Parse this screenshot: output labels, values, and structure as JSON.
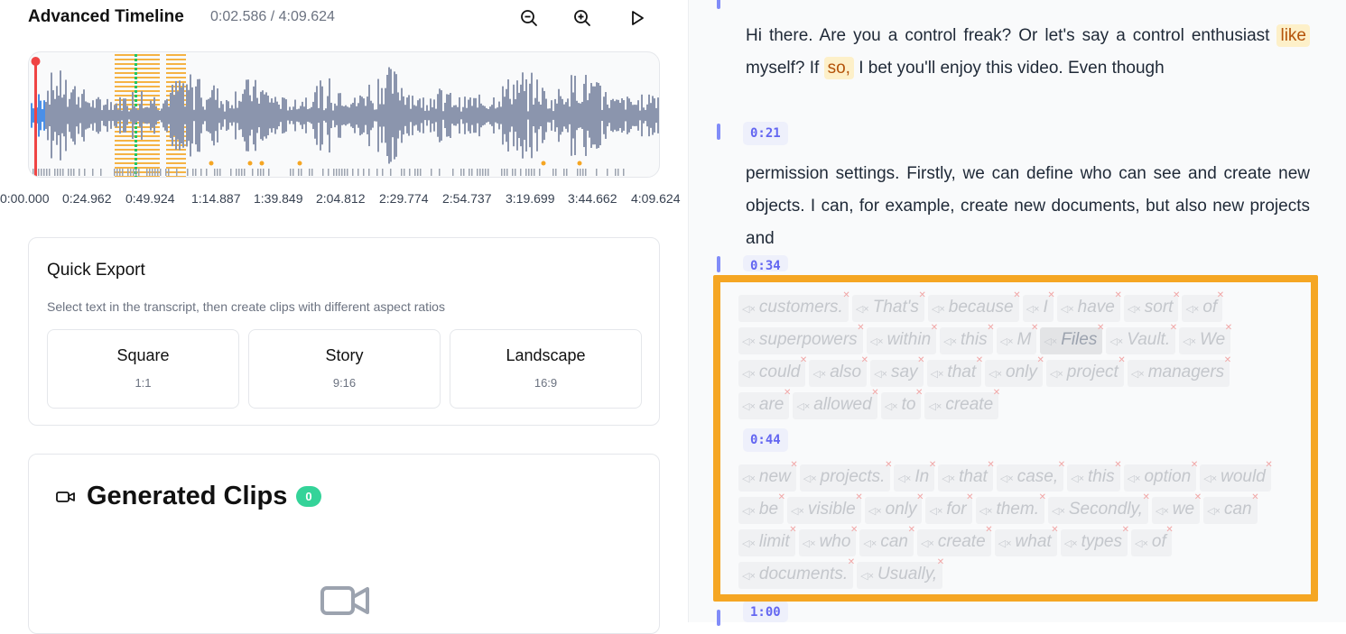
{
  "timeline": {
    "title": "Advanced Timeline",
    "time": "0:02.586 / 4:09.624",
    "ticks": [
      "0:00.000",
      "0:24.962",
      "0:49.924",
      "1:14.887",
      "1:39.849",
      "2:04.812",
      "2:29.774",
      "2:54.737",
      "3:19.699",
      "3:44.662",
      "4:09.624"
    ],
    "playhead_fraction": 0.01,
    "colors": {
      "wave": "#8b95ad",
      "wave_played": "#4a8fe7",
      "playhead": "#ef4444",
      "marker": "#f5a623",
      "cursor": "#22c55e"
    }
  },
  "quick_export": {
    "title": "Quick Export",
    "subtitle": "Select text in the transcript, then create clips with different aspect ratios",
    "ratios": [
      {
        "name": "Square",
        "value": "1:1"
      },
      {
        "name": "Story",
        "value": "9:16"
      },
      {
        "name": "Landscape",
        "value": "16:9"
      }
    ]
  },
  "generated_clips": {
    "title": "Generated Clips",
    "count": "0",
    "icon": "video-camera-icon"
  },
  "transcript": {
    "para1": {
      "before": "Hi there. Are you a control freak? Or let's say a control enthusiast",
      "hl1": "like",
      "mid": "myself? If",
      "hl2": "so,",
      "after": "I bet you'll enjoy this video. Even though"
    },
    "ts1": "0:21",
    "para2": "permission settings. Firstly, we can define who can see and create new objects. I can, for example, create new documents, but also new projects and",
    "ts2": "0:34",
    "faded1": [
      [
        "customers.",
        "That's",
        "because",
        "I",
        "have",
        "sort",
        "of"
      ],
      [
        "superpowers",
        "within",
        "this",
        "M",
        "Files",
        "Vault.",
        "We"
      ],
      [
        "could",
        "also",
        "say",
        "that",
        "only",
        "project",
        "managers"
      ],
      [
        "are",
        "allowed",
        "to",
        "create"
      ]
    ],
    "ts3": "0:44",
    "faded2": [
      [
        "new",
        "projects.",
        "In",
        "that",
        "case,",
        "this",
        "option",
        "would"
      ],
      [
        "be",
        "visible",
        "only",
        "for",
        "them.",
        "Secondly,",
        "we",
        "can"
      ],
      [
        "limit",
        "who",
        "can",
        "create",
        "what",
        "types",
        "of"
      ],
      [
        "documents.",
        "Usually,"
      ]
    ],
    "ts4": "1:00",
    "selected_word": "Files",
    "colors": {
      "timestamp": "#6366f1",
      "highlight_box": "#f5a623"
    }
  }
}
